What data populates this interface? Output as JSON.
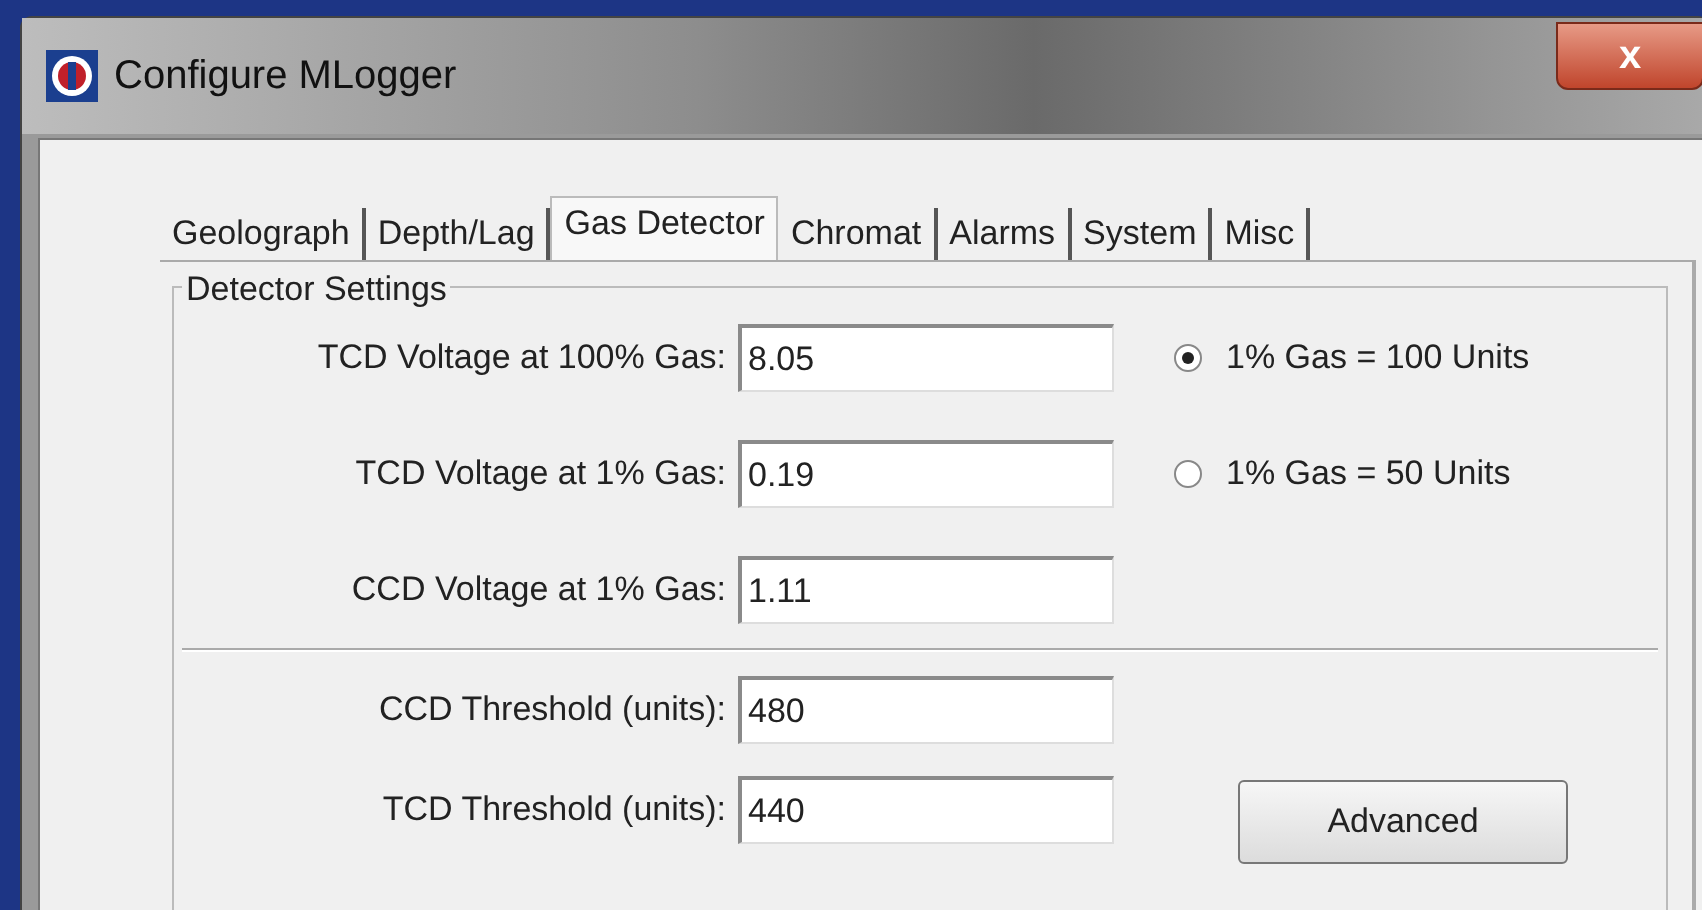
{
  "window": {
    "title": "Configure MLogger",
    "close": "x"
  },
  "tabs": [
    {
      "label": "Geolograph",
      "selected": false
    },
    {
      "label": "Depth/Lag",
      "selected": false
    },
    {
      "label": "Gas Detector",
      "selected": true
    },
    {
      "label": "Chromat",
      "selected": false
    },
    {
      "label": "Alarms",
      "selected": false
    },
    {
      "label": "System",
      "selected": false
    },
    {
      "label": "Misc",
      "selected": false
    }
  ],
  "group": {
    "title": "Detector Settings",
    "fields": [
      {
        "label": "TCD Voltage at 100% Gas:",
        "value": "8.05"
      },
      {
        "label": "TCD Voltage at 1% Gas:",
        "value": "0.19"
      },
      {
        "label": "CCD Voltage at 1% Gas:",
        "value": "1.11"
      }
    ],
    "radios": [
      {
        "label": "1% Gas = 100 Units",
        "selected": true
      },
      {
        "label": "1% Gas = 50 Units",
        "selected": false
      }
    ],
    "thresholds": [
      {
        "label": "CCD Threshold (units):",
        "value": "480"
      },
      {
        "label": "TCD Threshold (units):",
        "value": "440"
      }
    ],
    "button": "Advanced"
  }
}
